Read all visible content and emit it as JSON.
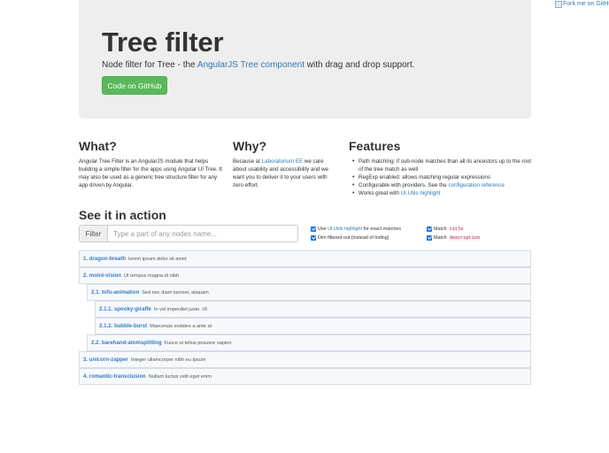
{
  "fork": {
    "alt_text": "Fork me on GitHub"
  },
  "jumbotron": {
    "title": "Tree filter",
    "lead_prefix": "Node filter for Tree - the ",
    "lead_link": "AngularJS Tree component",
    "lead_suffix": " with drag and drop support.",
    "button_label": "Code on GitHub"
  },
  "what": {
    "heading": "What?",
    "text": "Angular Tree Filter is an AngularJS module that helps building a simple filter for the apps using Angular UI Tree. It may also be used as a generic tree structure filter for any app driven by Angular."
  },
  "why": {
    "heading": "Why?",
    "text_prefix": "Because at ",
    "link": "Laboratorium EE",
    "text_suffix": " we care about usability and accessibility and we want you to deliver it to your users with zero effort."
  },
  "features": {
    "heading": "Features",
    "items": [
      {
        "text": "Path matching: if sub-node matches than all its ancestors up to the root of the tree match as well"
      },
      {
        "text": "RegExp enabled: allows matching regular expressions"
      },
      {
        "text": "Configurable with providers. See the ",
        "link": "configuration reference"
      },
      {
        "text": "Works great with ",
        "link": "UI.Utils highlight"
      }
    ]
  },
  "action": {
    "heading": "See it in action",
    "filter_addon": "Filter",
    "filter_placeholder": "Type a part of any nodes name...",
    "filter_value": ""
  },
  "options": {
    "use_highlight": {
      "prefix": "Use ",
      "link": "UI.Utils highlight",
      "suffix": " for exact matches",
      "checked": true
    },
    "dim_filtered": {
      "label": "Dim filtered out (instead of hiding)",
      "checked": true
    },
    "match_title": {
      "label": "Match",
      "code": "title",
      "checked": true
    },
    "match_description": {
      "label": "Match",
      "code": "description",
      "checked": true
    }
  },
  "tree": {
    "nodes": [
      {
        "title": "1. dragon-breath",
        "description": "lorem ipsum dolor sit amet",
        "depth": 0
      },
      {
        "title": "2. moiré-vision",
        "description": "Ut tempus magna id nibh",
        "depth": 0
      },
      {
        "title": "2.1. tofu-animation",
        "description": "Sed nec diam laoreet, aliquam",
        "depth": 1
      },
      {
        "title": "2.1.1. spooky-giraffe",
        "description": "In vel imperdiet justo. Ut",
        "depth": 2
      },
      {
        "title": "2.1.2. bubble-burst",
        "description": "Maecenas sodales a ante at",
        "depth": 2
      },
      {
        "title": "2.2. barehand-atomsplitting",
        "description": "Fusce ut tellus posuere sapien",
        "depth": 1
      },
      {
        "title": "3. unicorn-zapper",
        "description": "Integer ullamcorper nibh eu ipsum",
        "depth": 0
      },
      {
        "title": "4. romantic-transclusion",
        "description": "Nullam luctus velit eget enim",
        "depth": 0
      }
    ]
  },
  "colors": {
    "primary_link": "#337ab7",
    "success_button": "#5cb85c",
    "jumbotron_bg": "#eeeeee",
    "node_title": "#3a7bbf",
    "code_text": "#c7254e"
  }
}
